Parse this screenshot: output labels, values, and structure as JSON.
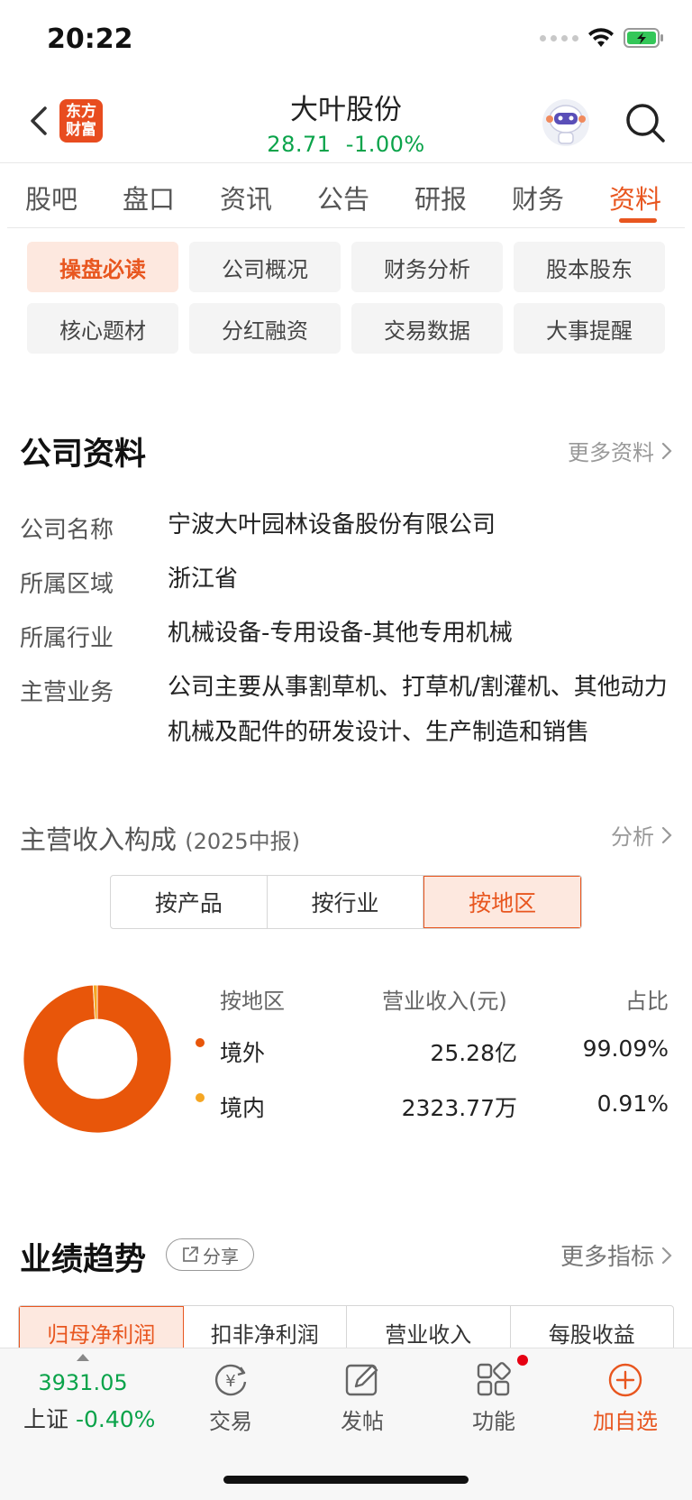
{
  "status": {
    "time": "20:22"
  },
  "header": {
    "logo_line1": "东方",
    "logo_line2": "财富",
    "stock_name": "大叶股份",
    "price": "28.71",
    "change": "-1.00%"
  },
  "tabs": [
    "股吧",
    "盘口",
    "资讯",
    "公告",
    "研报",
    "财务",
    "资料"
  ],
  "active_tab": "资料",
  "subtabs": [
    "操盘必读",
    "公司概况",
    "财务分析",
    "股本股东",
    "核心题材",
    "分红融资",
    "交易数据",
    "大事提醒"
  ],
  "company": {
    "title": "公司资料",
    "more": "更多资料",
    "rows": [
      {
        "label": "公司名称",
        "value": "宁波大叶园林设备股份有限公司"
      },
      {
        "label": "所属区域",
        "value": "浙江省"
      },
      {
        "label": "所属行业",
        "value": "机械设备-专用设备-其他专用机械"
      },
      {
        "label": "主营业务",
        "value": "公司主要从事割草机、打草机/割灌机、其他动力机械及配件的研发设计、生产制造和销售"
      }
    ]
  },
  "revenue": {
    "title": "主营收入构成",
    "period": "(2025中报)",
    "analyze": "分析",
    "segments": [
      "按产品",
      "按行业",
      "按地区"
    ],
    "active_segment": "按地区",
    "headers": [
      "按地区",
      "营业收入(元)",
      "占比"
    ],
    "rows": [
      {
        "name": "境外",
        "amount": "25.28亿",
        "ratio": "99.09%",
        "color": "#e8560a",
        "share": 99.09
      },
      {
        "name": "境内",
        "amount": "2323.77万",
        "ratio": "0.91%",
        "color": "#f5a623",
        "share": 0.91
      }
    ]
  },
  "performance": {
    "title": "业绩趋势",
    "share": "分享",
    "more": "更多指标",
    "tabs": [
      "归母净利润",
      "扣非净利润",
      "营业收入",
      "每股收益"
    ],
    "active": "归母净利润"
  },
  "bottom_nav": {
    "index_value": "3931.05",
    "index_name": "上证",
    "index_change": "-0.40%",
    "items": [
      "交易",
      "发帖",
      "功能",
      "加自选"
    ]
  },
  "colors": {
    "accent": "#e8561f",
    "up_green": "#0aa34a"
  }
}
